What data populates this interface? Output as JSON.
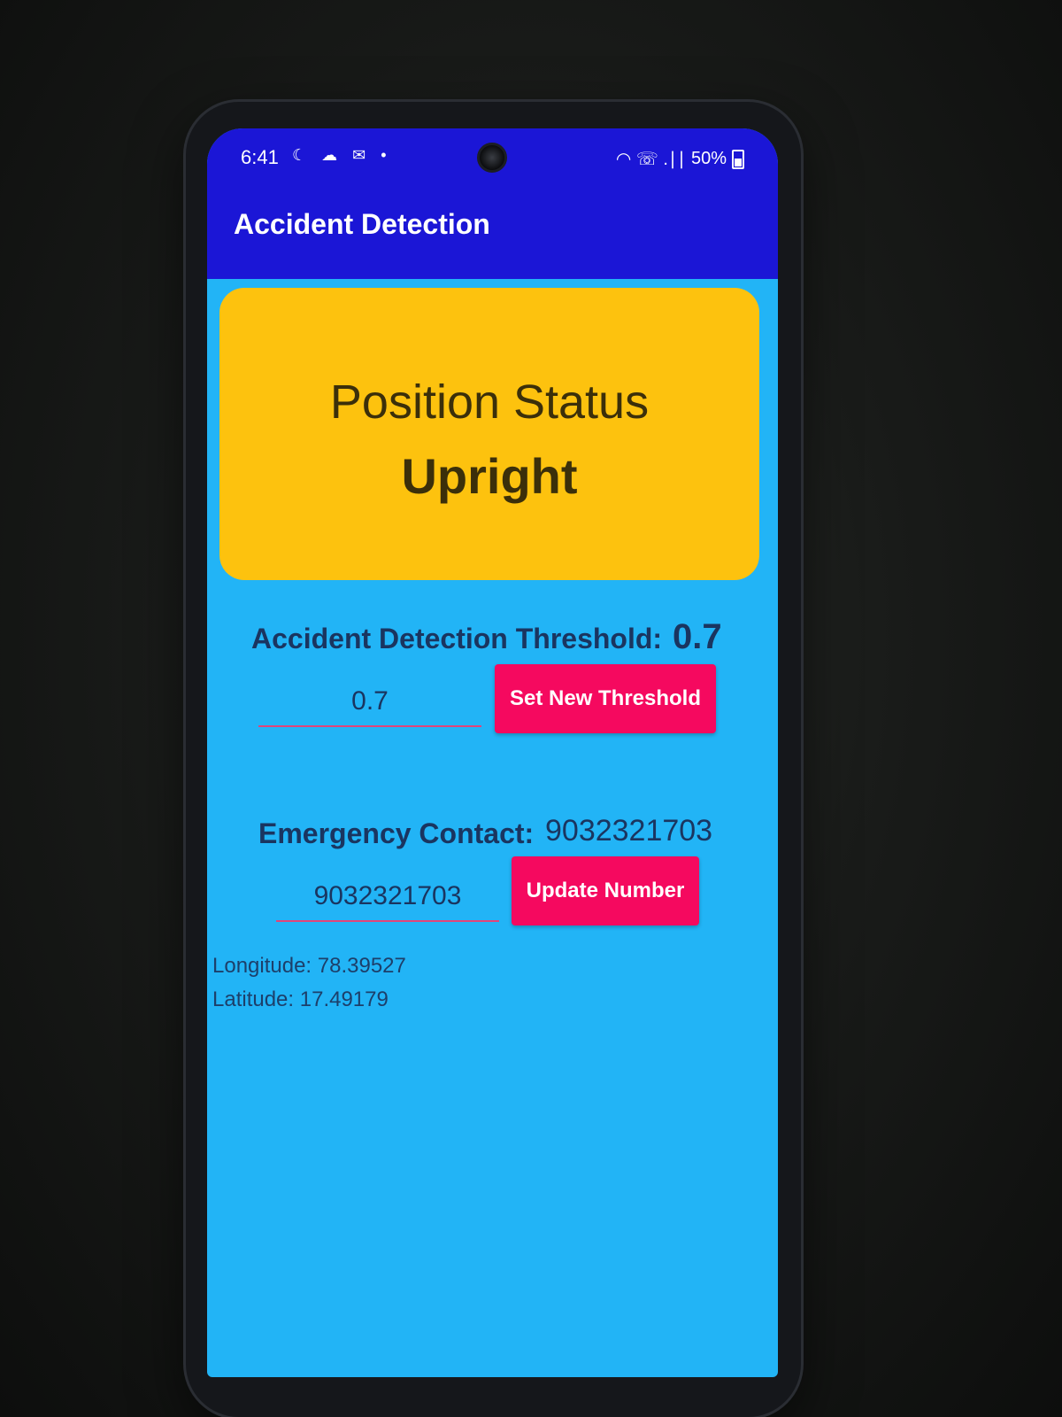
{
  "status_bar": {
    "time": "6:41",
    "left_icons": "☾ ☁ ✉ •",
    "battery_percent": "50%",
    "signal_icons": "◠ ☏ .∣∣"
  },
  "app_bar": {
    "title": "Accident Detection"
  },
  "position_card": {
    "heading": "Position Status",
    "value": "Upright",
    "background": "#fdc20e"
  },
  "threshold": {
    "label": "Accident Detection Threshold:",
    "current_value": "0.7",
    "input_value": "0.7",
    "button_label": "Set New Threshold"
  },
  "emergency": {
    "label": "Emergency Contact:",
    "current_value": "9032321703",
    "input_value": "9032321703",
    "button_label": "Update Number"
  },
  "location": {
    "longitude": "Longitude: 78.39527",
    "latitude": "Latitude: 17.49179"
  },
  "colors": {
    "app_bar": "#1b16d6",
    "screen_background": "#22b4f6",
    "button": "#f5095f",
    "text_dark": "#1a3560"
  }
}
